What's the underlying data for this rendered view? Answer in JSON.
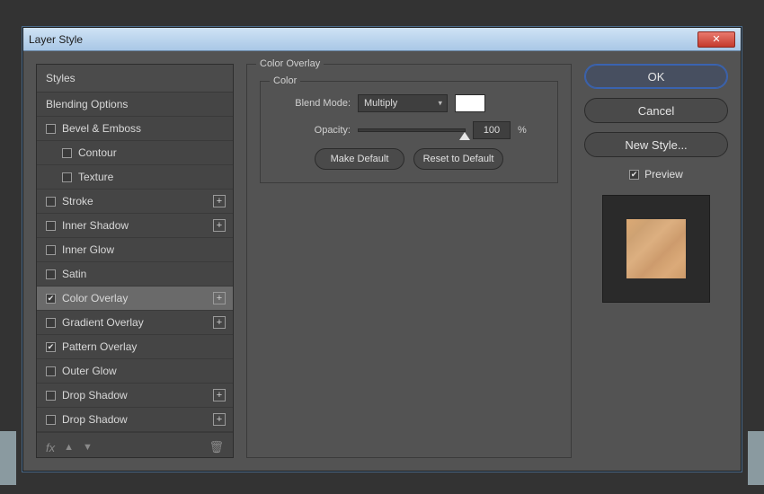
{
  "dialog": {
    "title": "Layer Style"
  },
  "sidebar": {
    "header": "Styles",
    "blending": "Blending Options",
    "items": [
      {
        "label": "Bevel & Emboss",
        "checked": false,
        "plus": false,
        "indent": false
      },
      {
        "label": "Contour",
        "checked": false,
        "plus": false,
        "indent": true
      },
      {
        "label": "Texture",
        "checked": false,
        "plus": false,
        "indent": true
      },
      {
        "label": "Stroke",
        "checked": false,
        "plus": true,
        "indent": false
      },
      {
        "label": "Inner Shadow",
        "checked": false,
        "plus": true,
        "indent": false
      },
      {
        "label": "Inner Glow",
        "checked": false,
        "plus": false,
        "indent": false
      },
      {
        "label": "Satin",
        "checked": false,
        "plus": false,
        "indent": false
      },
      {
        "label": "Color Overlay",
        "checked": true,
        "plus": true,
        "indent": false,
        "selected": true
      },
      {
        "label": "Gradient Overlay",
        "checked": false,
        "plus": true,
        "indent": false
      },
      {
        "label": "Pattern Overlay",
        "checked": true,
        "plus": false,
        "indent": false
      },
      {
        "label": "Outer Glow",
        "checked": false,
        "plus": false,
        "indent": false
      },
      {
        "label": "Drop Shadow",
        "checked": false,
        "plus": true,
        "indent": false
      },
      {
        "label": "Drop Shadow",
        "checked": false,
        "plus": true,
        "indent": false
      }
    ],
    "footer": {
      "fx": "fx"
    }
  },
  "panel": {
    "title": "Color Overlay",
    "groupTitle": "Color",
    "blendModeLabel": "Blend Mode:",
    "blendModeValue": "Multiply",
    "swatchHex": "#ffffff",
    "opacityLabel": "Opacity:",
    "opacityValue": "100",
    "opacityUnit": "%",
    "makeDefault": "Make Default",
    "resetDefault": "Reset to Default"
  },
  "buttons": {
    "ok": "OK",
    "cancel": "Cancel",
    "newStyle": "New Style...",
    "previewLabel": "Preview",
    "previewChecked": true
  }
}
